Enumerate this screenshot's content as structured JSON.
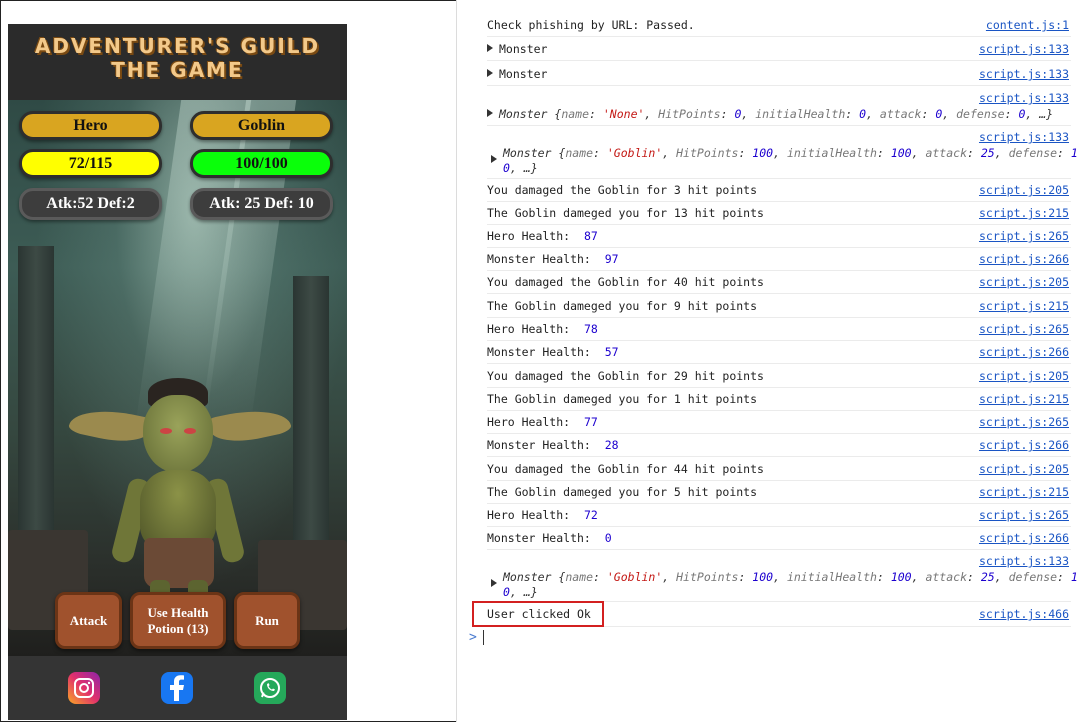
{
  "game": {
    "title_line1": "ADVENTURER'S GUILD",
    "title_line2": "THE GAME",
    "hero": {
      "name": "Hero",
      "health": "72/115",
      "stats": "Atk:52 Def:2"
    },
    "monster": {
      "name": "Goblin",
      "health": "100/100",
      "stats": "Atk: 25 Def: 10"
    },
    "buttons": {
      "attack": "Attack",
      "potion": "Use Health Potion (13)",
      "run": "Run"
    },
    "social": [
      {
        "icon": "instagram-icon",
        "color": "#e1306c"
      },
      {
        "icon": "facebook-icon",
        "color": "#1877f2"
      },
      {
        "icon": "whatsapp-icon",
        "color": "#25d366"
      }
    ]
  },
  "console": {
    "rows": [
      {
        "msg": "Check phishing by URL: Passed.",
        "src": "content.js:1"
      },
      {
        "msg": "Monster",
        "src": "script.js:133",
        "expandable": true
      },
      {
        "msg": "Monster",
        "src": "script.js:133",
        "expandable": true
      },
      {
        "src": "script.js:133",
        "obj": "Monster {name: 'None', HitPoints: 0, initialHealth: 0, attack: 0, defense: 0, …}"
      },
      {
        "src": "script.js:133",
        "obj_line1": "Monster {name: 'Goblin', HitPoints: 100, initialHealth: 100, attack: 25, defense: 1",
        "obj_line2": "0, …}"
      },
      {
        "msg": "You damaged the Goblin for 3 hit points",
        "src": "script.js:205"
      },
      {
        "msg": "The Goblin dameged you for 13 hit points",
        "src": "script.js:215"
      },
      {
        "label": "Hero Health:",
        "value": "87",
        "src": "script.js:265"
      },
      {
        "label": "Monster Health:",
        "value": "97",
        "src": "script.js:266"
      },
      {
        "msg": "You damaged the Goblin for 40 hit points",
        "src": "script.js:205"
      },
      {
        "msg": "The Goblin dameged you for 9 hit points",
        "src": "script.js:215"
      },
      {
        "label": "Hero Health:",
        "value": "78",
        "src": "script.js:265"
      },
      {
        "label": "Monster Health:",
        "value": "57",
        "src": "script.js:266"
      },
      {
        "msg": "You damaged the Goblin for 29 hit points",
        "src": "script.js:205"
      },
      {
        "msg": "The Goblin dameged you for 1 hit points",
        "src": "script.js:215"
      },
      {
        "label": "Hero Health:",
        "value": "77",
        "src": "script.js:265"
      },
      {
        "label": "Monster Health:",
        "value": "28",
        "src": "script.js:266"
      },
      {
        "msg": "You damaged the Goblin for 44 hit points",
        "src": "script.js:205"
      },
      {
        "msg": "The Goblin dameged you for 5 hit points",
        "src": "script.js:215"
      },
      {
        "label": "Hero Health:",
        "value": "72",
        "src": "script.js:265"
      },
      {
        "label": "Monster Health:",
        "value": "0",
        "src": "script.js:266"
      },
      {
        "src": "script.js:133",
        "obj_line1": "Monster {name: 'Goblin', HitPoints: 100, initialHealth: 100, attack: 25, defense: 1",
        "obj_line2": "0, …}"
      },
      {
        "msg": "User clicked Ok",
        "src": "script.js:466"
      }
    ],
    "prompt_symbol": ">"
  }
}
